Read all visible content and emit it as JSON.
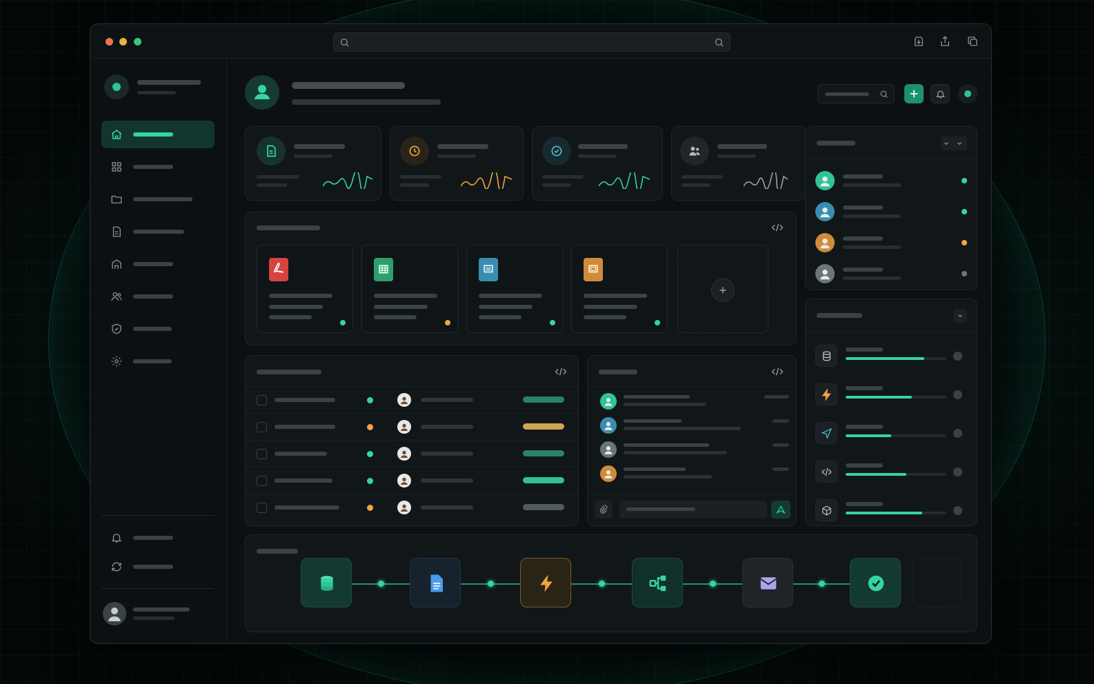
{
  "window": {
    "traffic_lights": [
      "#e8784f",
      "#e6b23c",
      "#3ec37a"
    ],
    "search_icon": "search-icon",
    "toolbar_icons": [
      "download-icon",
      "share-icon",
      "copy-icon"
    ]
  },
  "sidebar": {
    "brand_icon": "brand-logo",
    "nav_items": [
      {
        "icon": "home-icon",
        "active": true
      },
      {
        "icon": "grid-icon"
      },
      {
        "icon": "folder-icon"
      },
      {
        "icon": "document-icon"
      },
      {
        "icon": "building-icon"
      },
      {
        "icon": "users-icon"
      },
      {
        "icon": "shield-icon"
      },
      {
        "icon": "settings-icon"
      }
    ],
    "footer_items": [
      {
        "icon": "bell-icon"
      },
      {
        "icon": "refresh-icon"
      }
    ],
    "user_icon": "user-avatar-icon"
  },
  "header": {
    "avatar_icon": "user-icon",
    "actions": [
      "search-icon",
      "plus-icon",
      "bell-icon",
      "status-dot"
    ]
  },
  "stats": [
    {
      "icon": "document-icon",
      "spark_color": "#35d4a5"
    },
    {
      "icon": "clock-icon",
      "spark_color": "#f0a640"
    },
    {
      "icon": "check-circle-icon",
      "spark_color": "#35d4a5"
    },
    {
      "icon": "users-icon",
      "spark_color": "#9aa3a7"
    }
  ],
  "files": [
    {
      "icon": "pdf-icon",
      "color": "#d8433f",
      "status": "#35d4a5"
    },
    {
      "icon": "spreadsheet-icon",
      "color": "#2f9e6e",
      "status": "#f0a640"
    },
    {
      "icon": "doc-icon",
      "color": "#3a8db0",
      "status": "#35d4a5"
    },
    {
      "icon": "slides-icon",
      "color": "#d08b3a",
      "status": "#35d4a5"
    }
  ],
  "table_rows": [
    {
      "status": "#35d4a5",
      "pill": "#2e8f77"
    },
    {
      "status": "#f0a640",
      "pill": "#e8b45a"
    },
    {
      "status": "#35d4a5",
      "pill": "#2e8f77"
    },
    {
      "status": "#35d4a5",
      "pill": "#35d4a5"
    },
    {
      "status": "#f0a640",
      "pill": "#5a6468"
    }
  ],
  "chat_users": [
    "#2fc39a",
    "#3a8db0",
    "#6c757a",
    "#d08b3a"
  ],
  "team": [
    {
      "color": "#2fc39a",
      "status": "#35d4a5"
    },
    {
      "color": "#3a8db0",
      "status": "#35d4a5"
    },
    {
      "color": "#d08b3a",
      "status": "#f0a640"
    },
    {
      "color": "#6c757a",
      "status": "#6c757a"
    }
  ],
  "resources": [
    {
      "icon": "database-icon",
      "fill": 0.78
    },
    {
      "icon": "bolt-icon",
      "fill": 0.66
    },
    {
      "icon": "send-icon",
      "fill": 0.45
    },
    {
      "icon": "code-icon",
      "fill": 0.6
    },
    {
      "icon": "cube-icon",
      "fill": 0.76
    }
  ],
  "workflow": [
    "database-icon",
    "document-icon",
    "bolt-icon",
    "branch-icon",
    "mail-icon",
    "check-icon"
  ]
}
